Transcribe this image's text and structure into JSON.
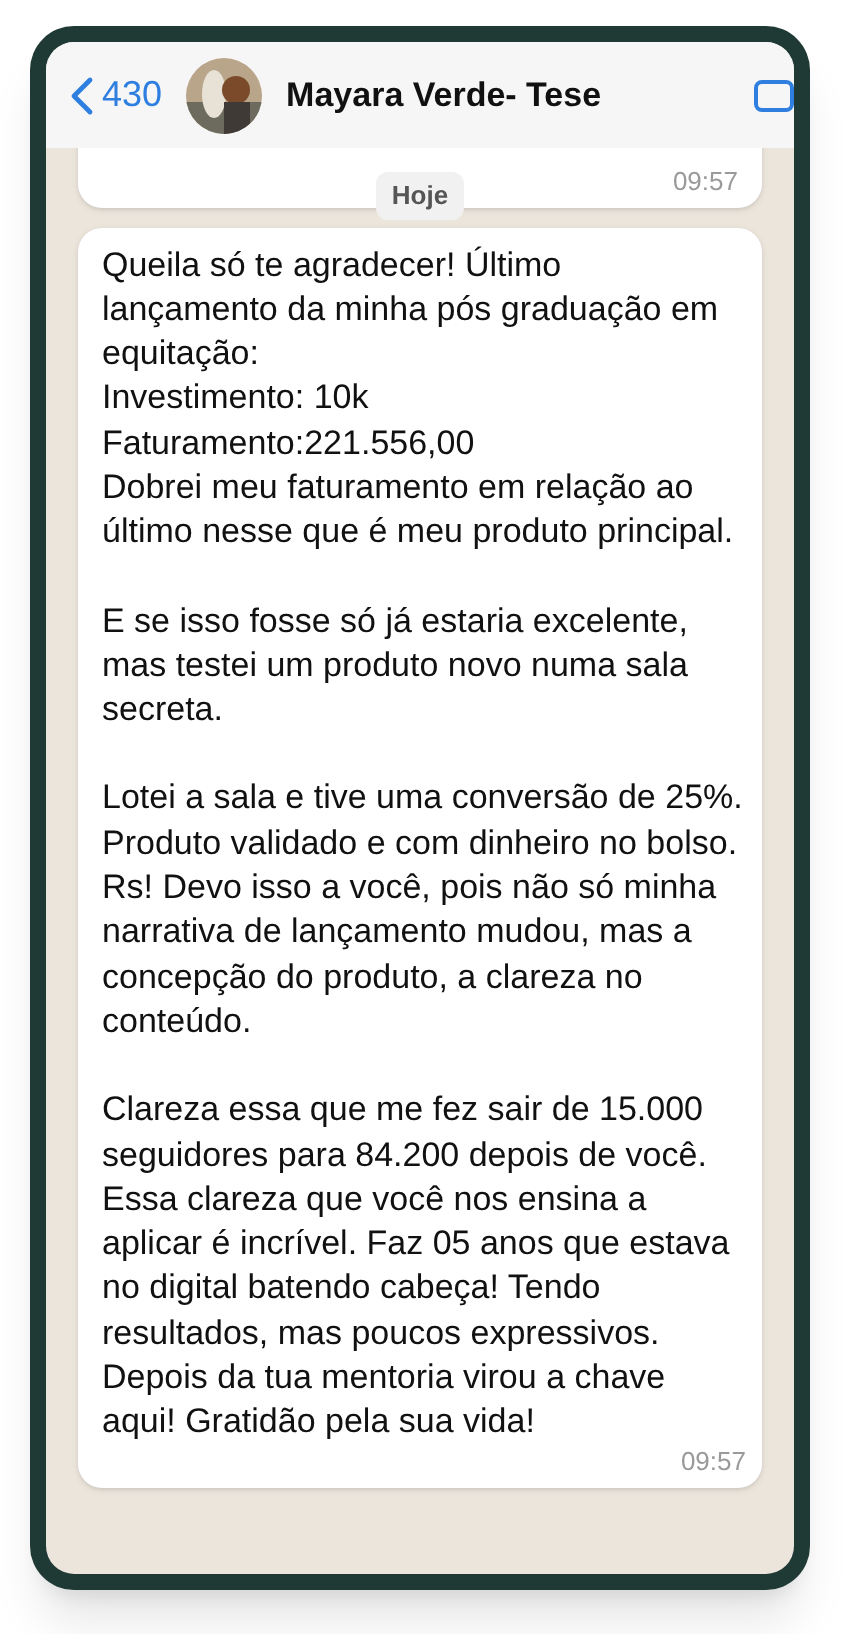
{
  "header": {
    "back_count": "430",
    "contact_name": "Mayara Verde- Tese"
  },
  "date_badge": "Hoje",
  "messages": [
    {
      "kind": "clipped",
      "time": "09:57"
    },
    {
      "kind": "full",
      "paragraphs": [
        "Queila só te agradecer! Último lançamento da minha pós graduação em equitação:\nInvestimento: 10k\nFaturamento:221.556,00\nDobrei meu faturamento em relação ao último nesse que é meu produto principal.",
        "E se isso fosse só já estaria excelente, mas testei um produto novo numa sala secreta.",
        "Lotei a sala e tive uma conversão de 25%. Produto validado e com dinheiro no bolso. Rs! Devo isso a você, pois não só minha narrativa de lançamento mudou, mas a concepção do produto, a clareza no conteúdo.",
        "Clareza essa que me fez sair de 15.000 seguidores para 84.200 depois de você. Essa clareza que você nos ensina a aplicar é incrível. Faz 05 anos que estava no digital batendo cabeça! Tendo resultados, mas poucos expressivos. Depois da tua mentoria virou a chave aqui! Gratidão pela sua vida!"
      ],
      "time": "09:57"
    }
  ]
}
